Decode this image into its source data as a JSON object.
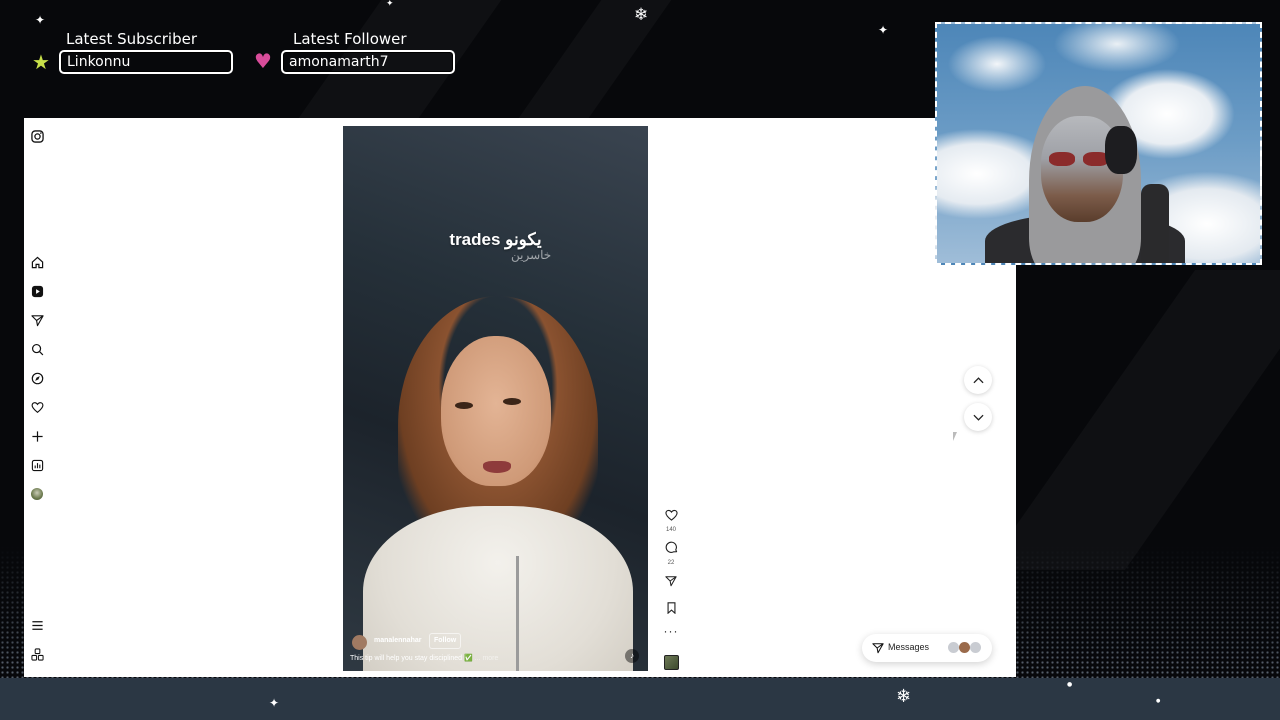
{
  "overlay": {
    "subscriber": {
      "title": "Latest Subscriber",
      "name": "Linkonnu",
      "icon": "star-icon"
    },
    "follower": {
      "title": "Latest Follower",
      "name": "amonamarth7",
      "icon": "heart-icon"
    },
    "colors": {
      "accent_star": "#c8e04a",
      "accent_heart": "#d84c9a",
      "band": "#2b3744"
    }
  },
  "instagram": {
    "sidebar": {
      "items": [
        {
          "name": "instagram-logo-icon"
        },
        {
          "name": "home-icon"
        },
        {
          "name": "reels-icon"
        },
        {
          "name": "messages-icon"
        },
        {
          "name": "search-icon"
        },
        {
          "name": "explore-icon"
        },
        {
          "name": "notifications-icon"
        },
        {
          "name": "create-icon"
        },
        {
          "name": "dashboard-icon"
        },
        {
          "name": "profile-avatar-icon"
        },
        {
          "name": "menu-icon"
        },
        {
          "name": "threads-icon"
        }
      ]
    },
    "reel": {
      "caption_main": "trades يكونو",
      "caption_sub": "خاسرين",
      "username": "manalennahar",
      "follow_label": "Follow",
      "description": "This tip will help you stay disciplined ✅",
      "more_label": "... more",
      "likes": "140",
      "comments": "22"
    },
    "messages_label": "Messages"
  }
}
